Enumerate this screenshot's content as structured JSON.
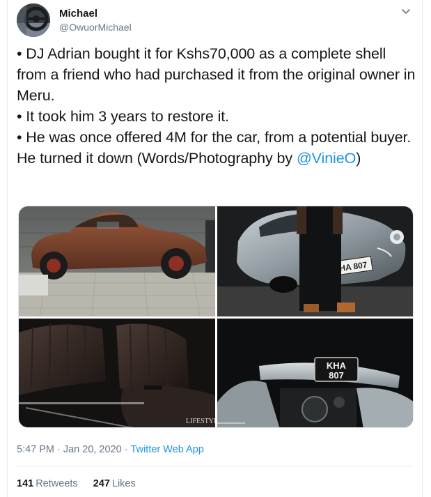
{
  "user": {
    "display_name": "Michael",
    "handle": "@OwuorMichael",
    "avatar_icon": "steering-wheel-avatar",
    "menu_icon": "chevron-down-icon"
  },
  "tweet": {
    "line1": "• DJ Adrian bought it for Kshs70,000 as a complete shell from a friend who had purchased it from the original owner in Meru.",
    "line2": "• It took him 3 years to restore it.",
    "line3_text": "• He was once offered 4M for the car, from a potential buyer. He turned it down (Words/Photography by ",
    "line3_mention": "@VinieO",
    "line3_end": ")"
  },
  "media": {
    "photo_3_watermark": "LIFESTYLE",
    "plate_line1": "KHA",
    "plate_line2": "807",
    "plate_single": "KHA 807"
  },
  "meta": {
    "time": "5:47 PM",
    "separator": "·",
    "date": "Jan 20, 2020",
    "source": "Twitter Web App"
  },
  "stats": {
    "retweets_count": "141",
    "retweets_label": "Retweets",
    "likes_count": "247",
    "likes_label": "Likes"
  },
  "colors": {
    "link": "#1b95e0",
    "secondary_text": "#657786",
    "primary_text": "#14171a",
    "border": "#e6ecf0"
  }
}
